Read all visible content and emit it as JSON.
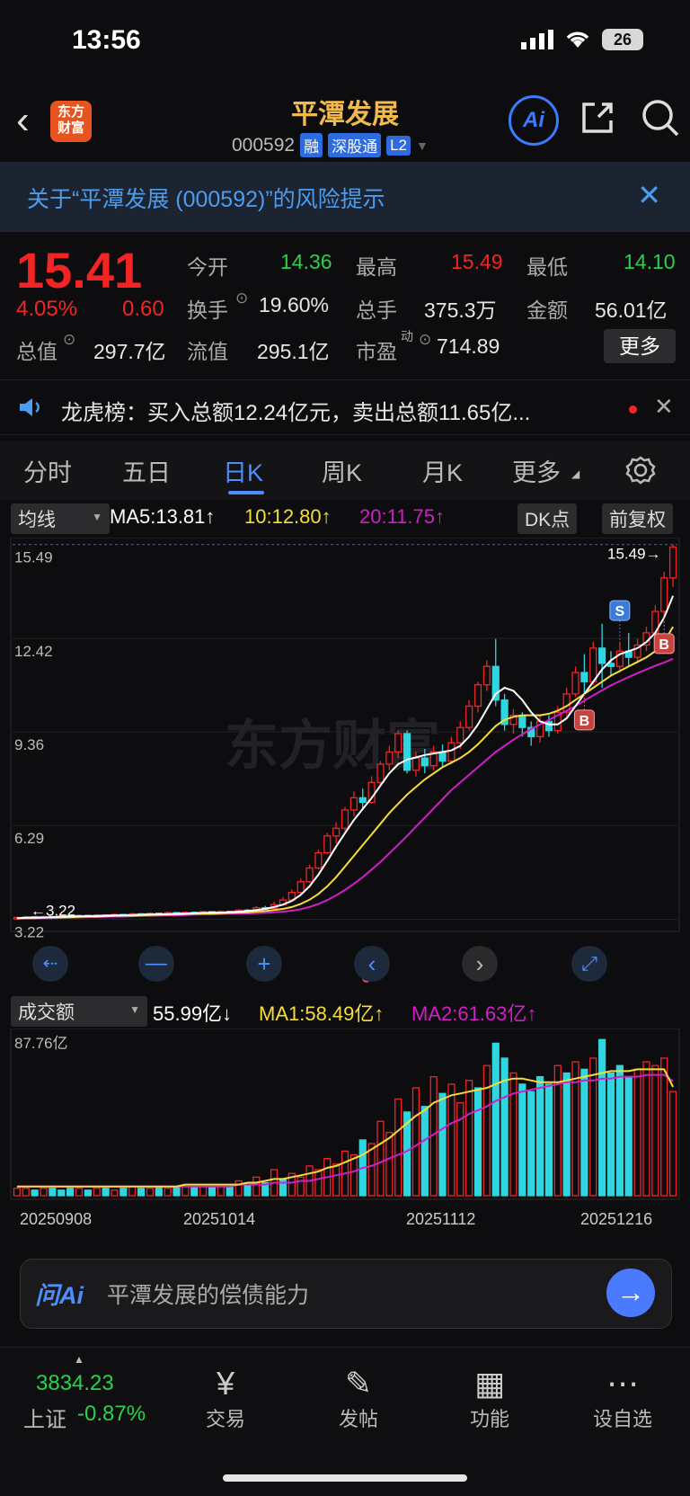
{
  "status": {
    "time": "13:56",
    "battery": "26"
  },
  "header": {
    "logo_line1": "东方",
    "logo_line2": "财富",
    "stock_name": "平潭发展",
    "code": "000592",
    "tags": [
      "融",
      "深股通",
      "L2"
    ],
    "ai_label": "Ai"
  },
  "risk_banner": {
    "text": "关于“平潭发展 (000592)”的风险提示"
  },
  "quote": {
    "price": "15.41",
    "change_pct": "4.05%",
    "change": "0.60",
    "open_label": "今开",
    "open": "14.36",
    "high_label": "最高",
    "high": "15.49",
    "low_label": "最低",
    "low": "14.10",
    "turnover_label": "换手",
    "turnover": "19.60%",
    "volume_label": "总手",
    "volume": "375.3万",
    "amount_label": "金额",
    "amount": "56.01亿",
    "mktcap_label": "总值",
    "mktcap": "297.7亿",
    "float_label": "流值",
    "float_cap": "295.1亿",
    "pe_label": "市盈",
    "pe_sup": "动",
    "pe": "714.89",
    "more": "更多"
  },
  "dragon_tiger": {
    "text": "龙虎榜：买入总额12.24亿元，卖出总额11.65亿..."
  },
  "tabs": [
    "分时",
    "五日",
    "日K",
    "周K",
    "月K",
    "更多"
  ],
  "active_tab": "日K",
  "indicator": {
    "type": "均线",
    "ma5": "MA5:13.81↑",
    "ma10": "10:12.80↑",
    "ma20": "20:11.75↑",
    "dk": "DK点",
    "adjust": "前复权"
  },
  "volume_indicator": {
    "type": "成交额",
    "value": "55.99亿↓",
    "ma1": "MA1:58.49亿↑",
    "ma2": "MA2:61.63亿↑",
    "max_label": "87.76亿"
  },
  "colors": {
    "up": "#f32424",
    "down": "#2fd6e0",
    "ma5": "#ffffff",
    "ma10": "#f5dd3a",
    "ma20": "#d21ec8",
    "accent": "#4c8dff"
  },
  "chart_data": {
    "type": "candlestick",
    "y_tick_labels": [
      "15.49",
      "12.42",
      "9.36",
      "6.29",
      "3.22"
    ],
    "ylim": [
      3.0,
      15.6
    ],
    "high_marker": "15.49",
    "low_marker": "3.22",
    "signals": [
      {
        "label": "S",
        "index": 68
      },
      {
        "label": "B",
        "index": 64
      },
      {
        "label": "B",
        "index": 73
      }
    ],
    "x_tick_labels": [
      "20250908",
      "20251014",
      "20251112",
      "20251216"
    ],
    "candles": [
      [
        3.25,
        3.28,
        3.22,
        3.3
      ],
      [
        3.28,
        3.3,
        3.25,
        3.33
      ],
      [
        3.3,
        3.27,
        3.24,
        3.32
      ],
      [
        3.27,
        3.31,
        3.25,
        3.34
      ],
      [
        3.31,
        3.29,
        3.26,
        3.33
      ],
      [
        3.29,
        3.33,
        3.27,
        3.36
      ],
      [
        3.33,
        3.31,
        3.28,
        3.35
      ],
      [
        3.31,
        3.35,
        3.29,
        3.38
      ],
      [
        3.35,
        3.32,
        3.3,
        3.37
      ],
      [
        3.32,
        3.36,
        3.3,
        3.39
      ],
      [
        3.36,
        3.34,
        3.31,
        3.38
      ],
      [
        3.34,
        3.38,
        3.32,
        3.41
      ],
      [
        3.38,
        3.36,
        3.33,
        3.4
      ],
      [
        3.36,
        3.4,
        3.34,
        3.43
      ],
      [
        3.4,
        3.38,
        3.35,
        3.42
      ],
      [
        3.38,
        3.42,
        3.36,
        3.45
      ],
      [
        3.42,
        3.4,
        3.37,
        3.44
      ],
      [
        3.4,
        3.44,
        3.38,
        3.47
      ],
      [
        3.44,
        3.41,
        3.39,
        3.46
      ],
      [
        3.41,
        3.45,
        3.39,
        3.48
      ],
      [
        3.45,
        3.43,
        3.4,
        3.47
      ],
      [
        3.43,
        3.47,
        3.41,
        3.5
      ],
      [
        3.47,
        3.44,
        3.42,
        3.49
      ],
      [
        3.44,
        3.48,
        3.42,
        3.51
      ],
      [
        3.48,
        3.46,
        3.43,
        3.5
      ],
      [
        3.46,
        3.52,
        3.44,
        3.55
      ],
      [
        3.52,
        3.5,
        3.47,
        3.56
      ],
      [
        3.5,
        3.6,
        3.48,
        3.65
      ],
      [
        3.6,
        3.58,
        3.54,
        3.66
      ],
      [
        3.58,
        3.7,
        3.56,
        3.8
      ],
      [
        3.7,
        3.85,
        3.66,
        3.95
      ],
      [
        3.85,
        4.1,
        3.8,
        4.2
      ],
      [
        4.1,
        4.45,
        4.05,
        4.55
      ],
      [
        4.45,
        4.9,
        4.4,
        5.0
      ],
      [
        4.9,
        5.4,
        4.85,
        5.5
      ],
      [
        5.4,
        5.95,
        5.35,
        6.05
      ],
      [
        5.95,
        6.2,
        5.7,
        6.4
      ],
      [
        6.2,
        6.8,
        6.1,
        6.9
      ],
      [
        6.8,
        7.2,
        6.6,
        7.4
      ],
      [
        7.2,
        7.05,
        6.8,
        7.5
      ],
      [
        7.05,
        7.7,
        7.0,
        7.9
      ],
      [
        7.7,
        8.3,
        7.6,
        8.4
      ],
      [
        8.3,
        8.7,
        8.1,
        8.9
      ],
      [
        8.7,
        9.3,
        8.5,
        9.4
      ],
      [
        9.3,
        8.1,
        8.0,
        9.4
      ],
      [
        8.1,
        8.5,
        7.9,
        8.7
      ],
      [
        8.5,
        8.25,
        8.0,
        8.8
      ],
      [
        8.25,
        8.7,
        8.1,
        8.9
      ],
      [
        8.7,
        8.4,
        8.2,
        8.95
      ],
      [
        8.4,
        9.0,
        8.3,
        9.2
      ],
      [
        9.0,
        9.5,
        8.8,
        9.7
      ],
      [
        9.5,
        10.2,
        9.4,
        10.4
      ],
      [
        10.2,
        10.9,
        10.0,
        11.0
      ],
      [
        10.9,
        11.5,
        10.7,
        11.7
      ],
      [
        11.5,
        10.4,
        10.2,
        12.4
      ],
      [
        10.4,
        9.6,
        9.4,
        10.6
      ],
      [
        9.6,
        9.9,
        9.3,
        10.1
      ],
      [
        9.9,
        9.5,
        9.2,
        10.0
      ],
      [
        9.5,
        9.2,
        8.9,
        9.7
      ],
      [
        9.2,
        9.7,
        9.0,
        9.9
      ],
      [
        9.7,
        9.4,
        9.2,
        9.9
      ],
      [
        9.4,
        10.0,
        9.3,
        10.2
      ],
      [
        10.0,
        10.6,
        9.9,
        10.8
      ],
      [
        10.6,
        11.3,
        10.5,
        11.5
      ],
      [
        11.3,
        11.0,
        10.6,
        11.9
      ],
      [
        11.0,
        12.1,
        10.9,
        12.3
      ],
      [
        12.1,
        11.6,
        10.8,
        12.9
      ],
      [
        11.6,
        11.5,
        11.2,
        12.0
      ],
      [
        11.5,
        12.0,
        11.3,
        12.3
      ],
      [
        12.0,
        11.8,
        11.5,
        12.6
      ],
      [
        11.8,
        12.2,
        11.6,
        12.4
      ],
      [
        12.2,
        12.6,
        12.0,
        12.8
      ],
      [
        12.6,
        13.3,
        12.4,
        13.5
      ],
      [
        13.3,
        14.4,
        13.1,
        14.6
      ],
      [
        14.4,
        15.41,
        14.1,
        15.49
      ]
    ],
    "ma5": [
      3.26,
      3.27,
      3.28,
      3.28,
      3.29,
      3.3,
      3.31,
      3.32,
      3.32,
      3.33,
      3.34,
      3.35,
      3.35,
      3.36,
      3.37,
      3.38,
      3.38,
      3.39,
      3.4,
      3.41,
      3.42,
      3.43,
      3.44,
      3.44,
      3.45,
      3.47,
      3.49,
      3.52,
      3.56,
      3.62,
      3.7,
      3.82,
      4.02,
      4.3,
      4.68,
      5.13,
      5.6,
      6.04,
      6.47,
      6.83,
      7.19,
      7.6,
      8.0,
      8.3,
      8.45,
      8.52,
      8.6,
      8.65,
      8.7,
      8.75,
      8.9,
      9.2,
      9.6,
      10.1,
      10.6,
      10.8,
      10.7,
      10.4,
      10.0,
      9.7,
      9.6,
      9.6,
      9.8,
      10.2,
      10.6,
      11.0,
      11.4,
      11.7,
      11.9,
      12.0,
      12.1,
      12.3,
      12.6,
      13.1,
      13.81
    ],
    "ma10": [
      3.25,
      3.26,
      3.26,
      3.27,
      3.28,
      3.28,
      3.29,
      3.3,
      3.31,
      3.31,
      3.32,
      3.33,
      3.34,
      3.34,
      3.35,
      3.36,
      3.37,
      3.37,
      3.38,
      3.39,
      3.4,
      3.41,
      3.41,
      3.42,
      3.43,
      3.44,
      3.45,
      3.47,
      3.49,
      3.52,
      3.56,
      3.62,
      3.72,
      3.86,
      4.05,
      4.3,
      4.6,
      4.95,
      5.3,
      5.65,
      6.0,
      6.35,
      6.7,
      7.0,
      7.3,
      7.55,
      7.8,
      8.0,
      8.2,
      8.35,
      8.5,
      8.7,
      8.95,
      9.25,
      9.55,
      9.75,
      9.85,
      9.9,
      9.9,
      9.9,
      9.95,
      10.05,
      10.2,
      10.4,
      10.6,
      10.8,
      11.0,
      11.2,
      11.35,
      11.5,
      11.65,
      11.8,
      12.0,
      12.3,
      12.8
    ],
    "ma20": [
      3.24,
      3.25,
      3.25,
      3.26,
      3.26,
      3.27,
      3.27,
      3.28,
      3.29,
      3.29,
      3.3,
      3.31,
      3.31,
      3.32,
      3.33,
      3.33,
      3.34,
      3.35,
      3.35,
      3.36,
      3.37,
      3.38,
      3.38,
      3.39,
      3.4,
      3.41,
      3.41,
      3.42,
      3.43,
      3.45,
      3.47,
      3.5,
      3.55,
      3.62,
      3.72,
      3.85,
      4.0,
      4.18,
      4.38,
      4.6,
      4.85,
      5.1,
      5.38,
      5.66,
      5.95,
      6.25,
      6.55,
      6.85,
      7.15,
      7.45,
      7.7,
      7.95,
      8.2,
      8.45,
      8.7,
      8.9,
      9.1,
      9.28,
      9.45,
      9.6,
      9.75,
      9.9,
      10.05,
      10.2,
      10.38,
      10.55,
      10.72,
      10.88,
      11.02,
      11.15,
      11.28,
      11.4,
      11.52,
      11.63,
      11.75
    ],
    "volume": [
      4,
      4,
      3,
      4,
      4,
      3,
      4,
      4,
      3,
      4,
      4,
      3,
      4,
      5,
      4,
      4,
      5,
      4,
      5,
      6,
      5,
      6,
      5,
      6,
      5,
      8,
      6,
      10,
      7,
      14,
      9,
      12,
      10,
      16,
      14,
      20,
      17,
      24,
      22,
      30,
      28,
      40,
      34,
      52,
      45,
      58,
      48,
      64,
      55,
      60,
      50,
      62,
      58,
      70,
      82,
      74,
      66,
      60,
      56,
      64,
      60,
      70,
      66,
      72,
      68,
      74,
      84,
      66,
      70,
      64,
      68,
      72,
      70,
      74,
      56
    ],
    "vol_down": [
      2,
      5,
      8,
      12,
      16,
      20,
      24,
      28,
      30,
      44,
      52,
      54,
      55,
      59,
      62,
      67,
      68
    ],
    "vol_ma1": [
      5,
      5,
      5,
      5,
      5,
      5,
      5,
      5,
      5,
      5,
      5,
      5,
      5,
      5,
      5,
      5,
      5,
      5,
      5,
      6,
      6,
      6,
      6,
      6,
      6,
      6,
      7,
      7,
      8,
      9,
      9,
      10,
      11,
      12,
      13,
      15,
      16,
      18,
      20,
      22,
      25,
      28,
      31,
      35,
      39,
      43,
      46,
      50,
      52,
      54,
      55,
      56,
      57,
      58,
      60,
      62,
      63,
      63,
      62,
      61,
      61,
      61,
      62,
      63,
      64,
      65,
      66,
      67,
      67,
      67,
      68,
      68,
      68,
      68,
      58.5
    ],
    "vol_ma2": [
      5,
      5,
      5,
      5,
      5,
      5,
      5,
      5,
      5,
      5,
      5,
      5,
      5,
      5,
      5,
      5,
      5,
      5,
      5,
      5,
      5,
      5,
      5,
      5,
      5,
      6,
      6,
      6,
      6,
      7,
      7,
      7,
      8,
      8,
      9,
      10,
      11,
      12,
      13,
      15,
      16,
      18,
      20,
      22,
      24,
      27,
      30,
      33,
      36,
      39,
      41,
      44,
      46,
      48,
      51,
      53,
      55,
      56,
      57,
      58,
      59,
      60,
      61,
      61,
      62,
      62,
      63,
      63,
      64,
      64,
      64,
      65,
      65,
      65,
      61.6
    ]
  },
  "ask": {
    "label": "问Ai",
    "placeholder": "平潭发展的偿债能力"
  },
  "bottom_nav": {
    "index_value": "3834.23",
    "index_name": "上证",
    "index_change": "-0.87%",
    "items": [
      "交易",
      "发帖",
      "功能",
      "设自选"
    ]
  }
}
